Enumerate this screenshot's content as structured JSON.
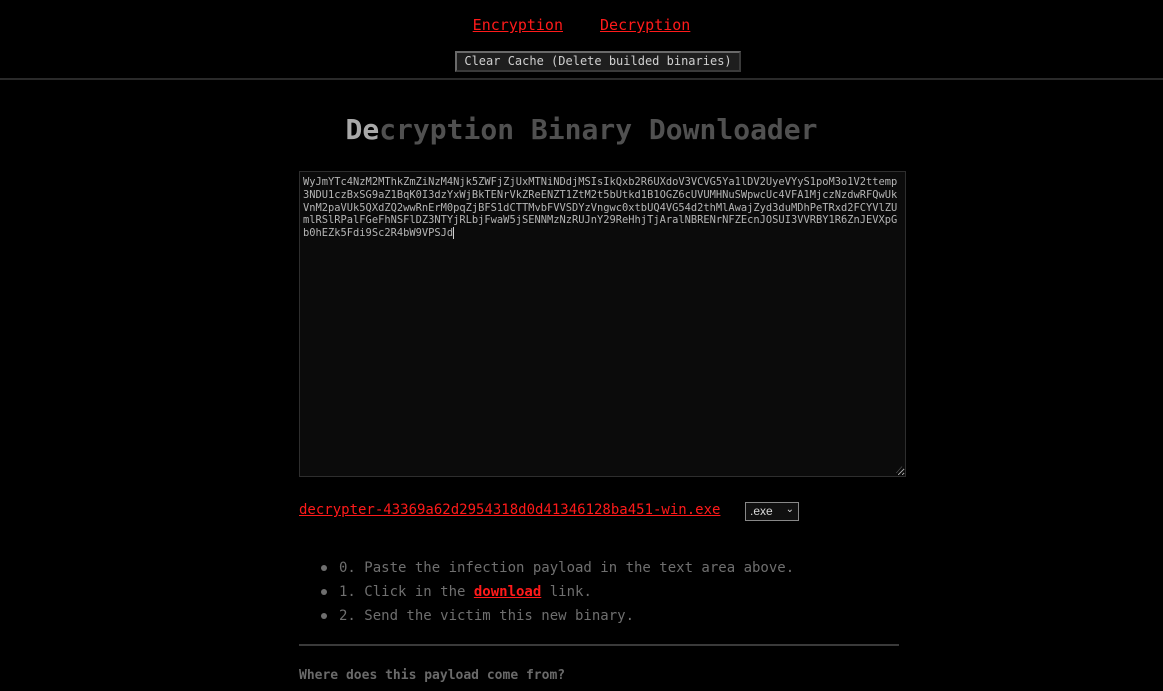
{
  "nav": {
    "encryption_label": "Encryption",
    "decryption_label": "Decryption",
    "clear_cache_label": "Clear Cache (Delete builded binaries)"
  },
  "page": {
    "title_accent": "De",
    "title_rest": "cryption Binary Downloader"
  },
  "payload": {
    "value": "WyJmYTc4NzM2MThkZmZiNzM4Njk5ZWFjZjUxMTNiNDdjMSIsIkQxb2R6UXdoV3VCVG5Ya1lDV2UyeVYyS1poM3o1V2ttemp3NDU1czBxSG9aZ1BqK0I3dzYxWjBkTENrVkZReENZT1ZtM2t5bUtkd1B1OGZ6cUVUMHNuSWpwcUc4VFA1MjczNzdwRFQwUkVnM2paVUk5QXdZQ2wwRnErM0pqZjBFS1dCTTMvbFVVSDYzVngwc0xtbUQ4VG54d2thMlAwajZyd3duMDhPeTRxd2FCYVlZUmlRSlRPalFGeFhNSFlDZ3NTYjRLbjFwaW5jSENNMzNzRUJnY29ReHhjTjAralNBRENrNFZEcnJOSUI3VVRBY1R6ZnJEVXpGb0hEZk5Fdi9Sc2R4bW9VPSJd"
  },
  "download": {
    "filename": "decrypter-43369a62d2954318d0d41346128ba451-win.exe",
    "extension_selected": ".exe"
  },
  "steps": {
    "step0": "0. Paste the infection payload in the text area above.",
    "step1_prefix": "1. Click in the ",
    "step1_link": "download",
    "step1_suffix": " link.",
    "step2": "2. Send the victim this new binary."
  },
  "faq": {
    "question": "Where does this payload come from?"
  },
  "colors": {
    "background": "#000000",
    "link": "#ff1a1a",
    "muted_text": "#6f6f6f",
    "title_dim": "#505050",
    "title_accent": "#a9a9a9"
  }
}
